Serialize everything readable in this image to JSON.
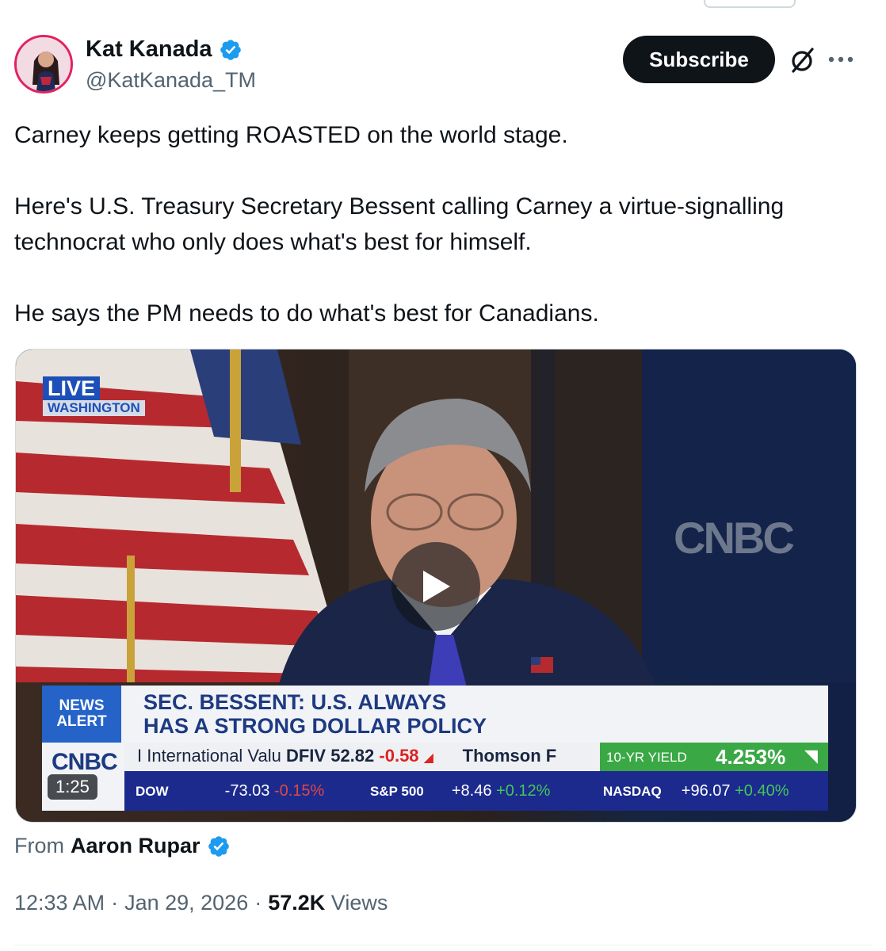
{
  "author": {
    "name": "Kat Kanada",
    "handle": "@KatKanada_TM",
    "verified_color": "#1d9bf0"
  },
  "actions": {
    "subscribe_label": "Subscribe",
    "grok_icon": "slashed-circle-icon",
    "more_icon": "more-dots-icon"
  },
  "tweet": {
    "paragraphs": [
      "Carney keeps getting ROASTED on the world stage.",
      "Here's U.S. Treasury Secretary Bessent calling Carney  a virtue-signalling technocrat who only does what's best for himself.",
      "He says the PM needs to do what's best for Canadians."
    ]
  },
  "video": {
    "live_label": "LIVE",
    "location": "WASHINGTON",
    "wall_logo": "CNBC",
    "alert_line1": "NEWS",
    "alert_line2": "ALERT",
    "headline_line1": "SEC. BESSENT: U.S. ALWAYS",
    "headline_line2": "HAS A STRONG DOLLAR POLICY",
    "logo": "CNBC",
    "ticker_text": "I International Valu",
    "ticker_symbol": "DFIV",
    "ticker_price": "52.82",
    "ticker_change": "-0.58",
    "ticker_next": "Thomson F",
    "yield_label": "10-YR YIELD",
    "yield_value": "4.253%",
    "markets": [
      {
        "label": "DOW",
        "value": "-73.03",
        "pct": "-0.15%"
      },
      {
        "label": "S&P 500",
        "value": "+8.46",
        "pct": "+0.12%"
      },
      {
        "label": "NASDAQ",
        "value": "+96.07",
        "pct": "+0.40%"
      }
    ],
    "duration": "1:25"
  },
  "source": {
    "from_label": "From",
    "name": "Aaron Rupar"
  },
  "meta": {
    "time": "12:33 AM",
    "separator": "·",
    "date": "Jan 29, 2026",
    "views_count": "57.2K",
    "views_label": "Views"
  }
}
